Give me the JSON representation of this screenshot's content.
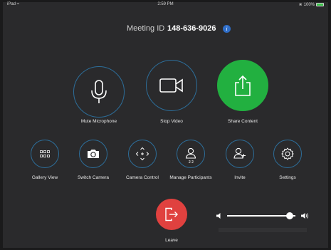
{
  "status_bar": {
    "device": "iPad",
    "time": "2:59 PM",
    "battery": "100%"
  },
  "meeting": {
    "label": "Meeting ID",
    "id": "148-636-9026"
  },
  "primary_actions": [
    {
      "label": "Mute Microphone"
    },
    {
      "label": "Stop Video"
    },
    {
      "label": "Share Content"
    }
  ],
  "secondary_actions": [
    {
      "label": "Gallery View"
    },
    {
      "label": "Switch Camera"
    },
    {
      "label": "Camera Control"
    },
    {
      "label": "Manage Participants",
      "count": "2 2"
    },
    {
      "label": "Invite"
    },
    {
      "label": "Settings"
    }
  ],
  "leave": {
    "label": "Leave"
  },
  "volume": {
    "level": 0.92
  },
  "colors": {
    "background": "#2a2a2c",
    "ring": "#2d6e9a",
    "share": "#22b040",
    "leave": "#e0413f",
    "info": "#2f6ec9"
  }
}
